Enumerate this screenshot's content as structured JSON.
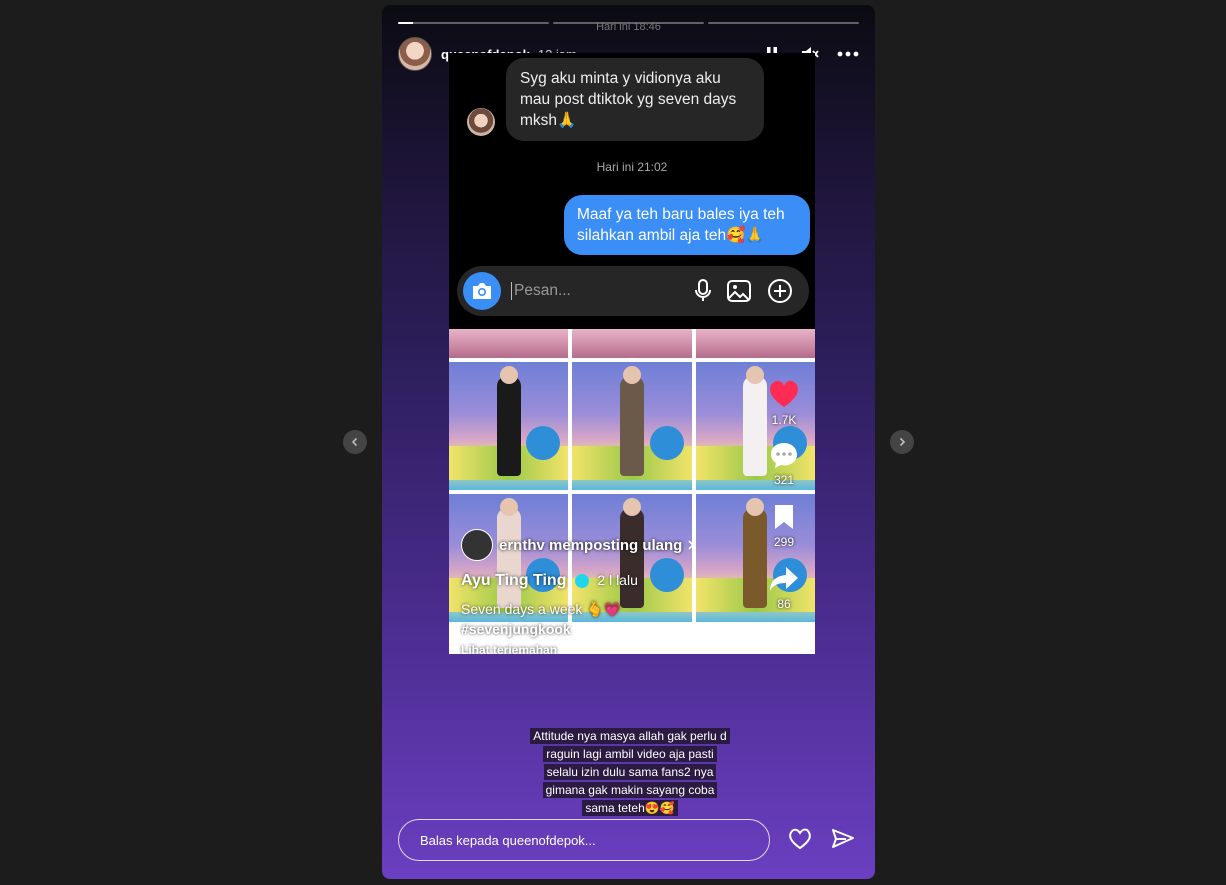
{
  "story": {
    "progress": [
      0.1,
      0,
      0
    ],
    "faded_date": "Hari ini 18:46",
    "username": "queenofdepok",
    "time_ago": "12 jam",
    "caption": "Attitude nya masya allah gak perlu d raguin lagi ambil video aja pasti selalu izin dulu sama fans2 nya gimana gak makin sayang coba sama teteh😍🥰"
  },
  "chat": {
    "incoming": "Syg aku minta y vidionya aku mau post dtiktok yg seven days mksh🙏",
    "timestamp": "Hari ini 21:02",
    "outgoing": "Maaf ya teh baru bales iya teh silahkan ambil aja teh🥰🙏",
    "placeholder": "Pesan..."
  },
  "tiktok": {
    "reposted": "ernthv memposting ulang",
    "creator": "Ayu Ting Ting",
    "age": "2 l lalu",
    "caption": "Seven days a week 🫰💗",
    "hashtag": "#sevenjungkook",
    "translation": "Lihat terjemahan",
    "likes": "1.7K",
    "comments": "321",
    "saves": "299",
    "shares": "86"
  },
  "reply": {
    "placeholder": "Balas kepada queenofdepok..."
  },
  "colors": {
    "accent_blue": "#3a8ef6",
    "like_red": "#fe2c55"
  },
  "icons": [
    "pause-icon",
    "mute-icon",
    "more-icon",
    "camera-icon",
    "mic-icon",
    "image-icon",
    "plus-icon",
    "heart-icon",
    "send-icon",
    "chevron-left-icon",
    "chevron-right-icon"
  ]
}
